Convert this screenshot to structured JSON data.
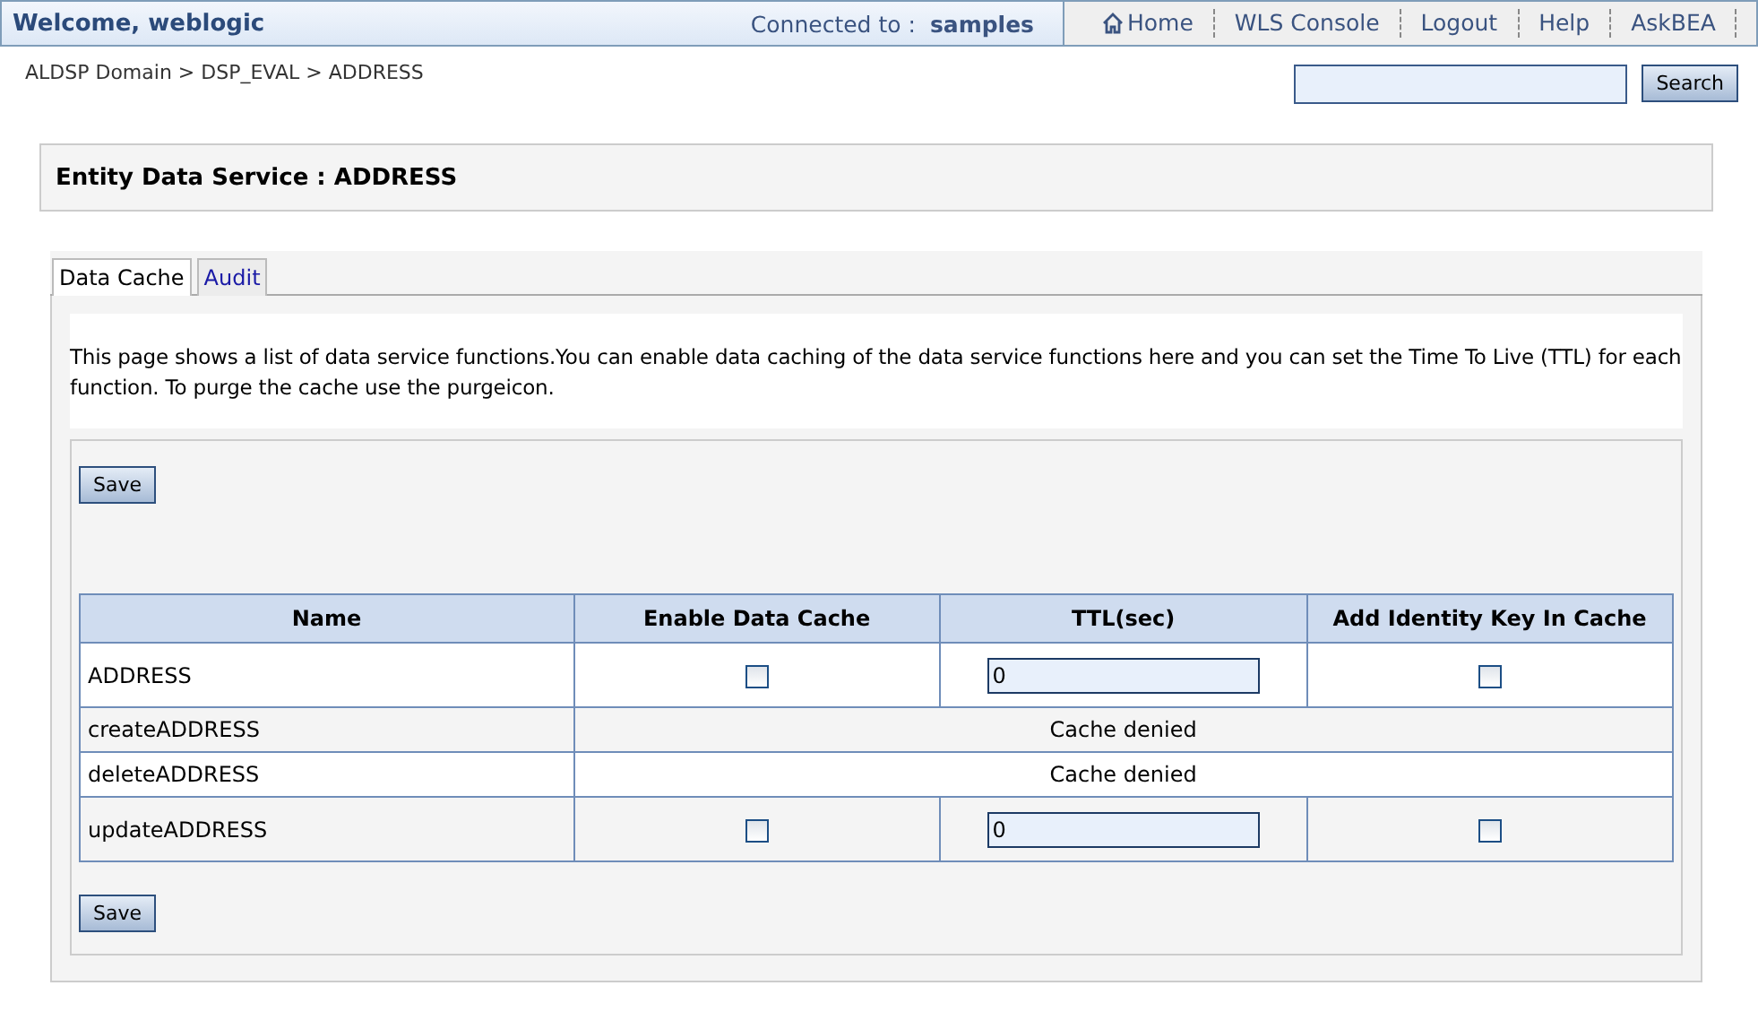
{
  "header": {
    "welcome": "Welcome, weblogic",
    "connected_label": "Connected to :",
    "connected_value": "samples",
    "nav": [
      "Home",
      "WLS Console",
      "Logout",
      "Help",
      "AskBEA"
    ]
  },
  "breadcrumb": "ALDSP Domain > DSP_EVAL > ADDRESS",
  "search": {
    "button": "Search"
  },
  "title": "Entity Data Service : ADDRESS",
  "tabs": [
    {
      "label": "Data Cache",
      "selected": true
    },
    {
      "label": "Audit",
      "selected": false
    }
  ],
  "description": "This page shows a list of data service functions.You can enable data caching of the data service functions here and you can set the Time To Live (TTL) for each function. To purge the cache use the purgeicon.",
  "save_button": "Save",
  "table": {
    "columns": [
      "Name",
      "Enable Data Cache",
      "TTL(sec)",
      "Add Identity Key In Cache"
    ],
    "rows": [
      {
        "kind": "editable",
        "name": "ADDRESS",
        "enable_cache": false,
        "ttl": "0",
        "identity_key": false
      },
      {
        "kind": "denied",
        "name": "createADDRESS",
        "message": "Cache denied"
      },
      {
        "kind": "denied",
        "name": "deleteADDRESS",
        "message": "Cache denied"
      },
      {
        "kind": "editable",
        "name": "updateADDRESS",
        "enable_cache": false,
        "ttl": "0",
        "identity_key": false
      }
    ]
  },
  "save_button_bottom": "Save"
}
